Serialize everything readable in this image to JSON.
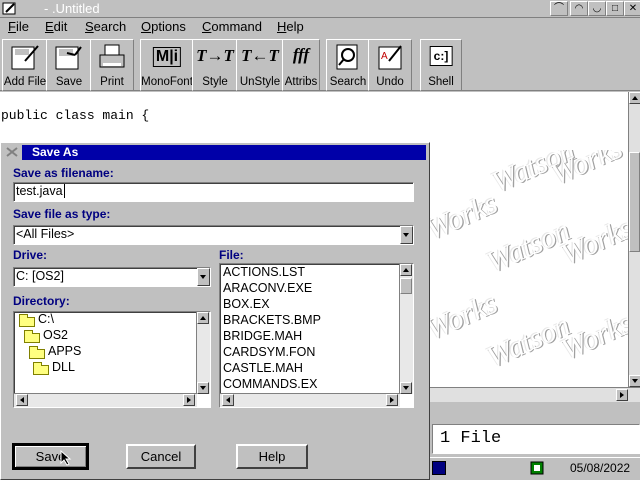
{
  "window": {
    "title": "- .Untitled"
  },
  "menu": [
    {
      "label": "File",
      "ul": "F",
      "rest": "ile"
    },
    {
      "label": "Edit",
      "ul": "E",
      "rest": "dit"
    },
    {
      "label": "Search",
      "ul": "S",
      "rest": "earch"
    },
    {
      "label": "Options",
      "ul": "O",
      "rest": "ptions"
    },
    {
      "label": "Command",
      "ul": "C",
      "rest": "ommand"
    },
    {
      "label": "Help",
      "ul": "H",
      "rest": "elp"
    }
  ],
  "toolbar": {
    "add_file": "Add File",
    "save": "Save",
    "print": "Print",
    "monofont": "MonoFont",
    "style": "Style",
    "unstyle": "UnStyle",
    "attribs": "Attribs",
    "search": "Search",
    "undo": "Undo",
    "shell": "Shell",
    "monofont_glyph": "M|i",
    "style_glyph": "T→T",
    "unstyle_glyph": "T←T",
    "attribs_glyph": "fff",
    "shell_glyph": "c:]"
  },
  "editor": {
    "code_line": "public class main {",
    "watermark": [
      "Watson",
      "Works",
      "Watson",
      "Works",
      "Watson",
      "Works"
    ]
  },
  "status": {
    "file_count": "1 File",
    "date": "05/08/2022"
  },
  "dialog": {
    "title": "Save As",
    "filename_label": "Save as filename:",
    "filename_value": "test.java",
    "type_label": "Save file as type:",
    "type_value": "<All Files>",
    "drive_label": "Drive:",
    "drive_value": "C:  [OS2]",
    "file_label": "File:",
    "files": [
      "ACTIONS.LST",
      "ARACONV.EXE",
      "BOX.EX",
      "BRACKETS.BMP",
      "BRIDGE.MAH",
      "CARDSYM.FON",
      "CASTLE.MAH",
      "COMMANDS.EX"
    ],
    "directory_label": "Directory:",
    "directories": [
      "C:\\",
      "OS2",
      "APPS",
      "DLL"
    ],
    "save_button": "Save",
    "cancel_button": "Cancel",
    "help_button": "Help"
  }
}
